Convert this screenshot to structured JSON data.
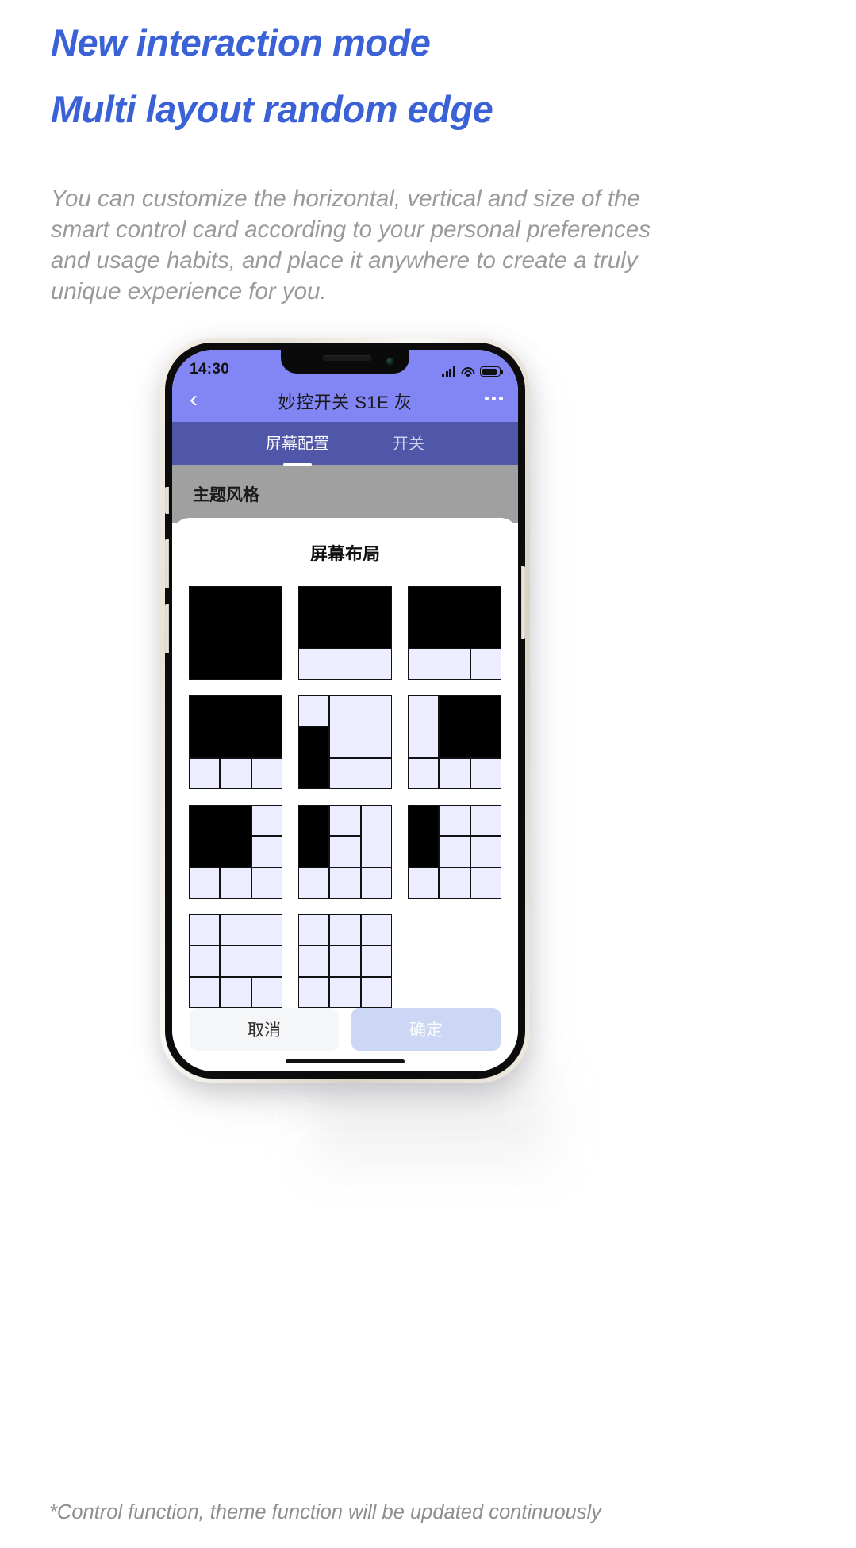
{
  "headline": {
    "line1": "New interaction mode",
    "line2": "Multi layout random edge",
    "color": "#3a62d6"
  },
  "description": "You can customize the horizontal, vertical and size of the smart control card according to your personal preferences and usage habits, and place it anywhere to create a truly unique experience for you.",
  "footer_note": "*Control function, theme function will be updated continuously",
  "phone": {
    "status_bar": {
      "time": "14:30",
      "signal_icon": "cellular-signal-icon",
      "wifi_icon": "wifi-icon",
      "battery_icon": "battery-icon"
    },
    "nav": {
      "back_icon": "chevron-left-icon",
      "title": "妙控开关 S1E 灰",
      "more_icon": "more-horizontal-icon"
    },
    "tabs": [
      {
        "label": "屏幕配置",
        "active": true
      },
      {
        "label": "开关",
        "active": false
      }
    ],
    "theme_section": {
      "label": "主题风格"
    },
    "sheet": {
      "title": "屏幕布局",
      "layouts": [
        {
          "name": "layout-1-full-black",
          "cells": [
            "b",
            "b",
            "b",
            "b",
            "b",
            "b",
            "b",
            "b",
            "b"
          ]
        },
        {
          "name": "layout-2-black-top-wide",
          "cells": [
            "b",
            "b",
            "b",
            "b",
            "b",
            "b",
            "w",
            "w",
            "w"
          ]
        },
        {
          "name": "layout-3-black-top-split",
          "cells": [
            "b",
            "b",
            "b",
            "b",
            "b",
            "b",
            "w",
            "w",
            "w"
          ]
        },
        {
          "name": "layout-4-black-top-3cells",
          "cells": [
            "b",
            "b",
            "b",
            "b",
            "b",
            "b",
            "w",
            "w",
            "w"
          ]
        },
        {
          "name": "layout-5-left-black-mid",
          "cells": [
            "w",
            "w",
            "w",
            "b",
            "w",
            "w",
            "w",
            "w",
            "w"
          ]
        },
        {
          "name": "layout-6-black-right-top",
          "cells": [
            "w",
            "b",
            "b",
            "w",
            "b",
            "b",
            "w",
            "w",
            "w"
          ]
        },
        {
          "name": "layout-7-black-left-2x2",
          "cells": [
            "b",
            "b",
            "w",
            "b",
            "b",
            "w",
            "w",
            "w",
            "w"
          ]
        },
        {
          "name": "layout-8-black-left-tall",
          "cells": [
            "b",
            "w",
            "w",
            "b",
            "w",
            "w",
            "w",
            "w",
            "w"
          ]
        },
        {
          "name": "layout-9-black-left-single",
          "cells": [
            "b",
            "w",
            "w",
            "w",
            "w",
            "w",
            "w",
            "w",
            "w"
          ]
        },
        {
          "name": "layout-10-all-white-grid",
          "cells": [
            "w",
            "w",
            "w",
            "w",
            "w",
            "w",
            "w",
            "w",
            "w"
          ]
        },
        {
          "name": "layout-11-all-white-grid-2",
          "cells": [
            "w",
            "w",
            "w",
            "w",
            "w",
            "w",
            "w",
            "w",
            "w"
          ]
        }
      ],
      "buttons": {
        "cancel": "取消",
        "confirm": "确定"
      }
    }
  },
  "colors": {
    "header_purple": "#8186f4",
    "tab_purple": "#5157a8",
    "theme_gray": "#a0a0a0",
    "cell_white": "#eceeff",
    "cell_black": "#000000"
  }
}
